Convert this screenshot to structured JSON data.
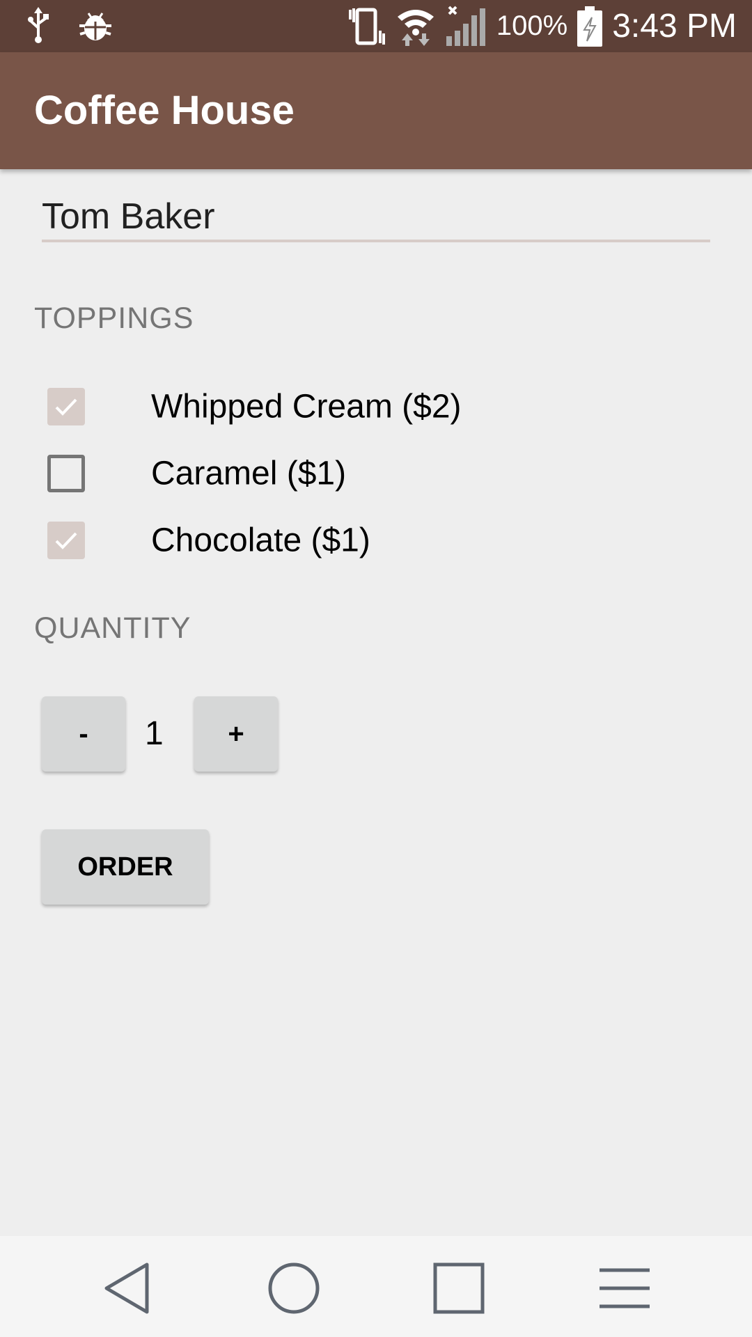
{
  "status_bar": {
    "battery_text": "100%",
    "time": "3:43 PM",
    "icons": [
      "usb-icon",
      "bug-icon",
      "vibrate-icon",
      "wifi-icon",
      "signal-icon",
      "battery-charging-icon"
    ]
  },
  "app_bar": {
    "title": "Coffee House"
  },
  "form": {
    "name_value": "Tom Baker",
    "toppings_label": "TOPPINGS",
    "toppings": [
      {
        "label": "Whipped Cream ($2)",
        "checked": true
      },
      {
        "label": "Caramel ($1)",
        "checked": false
      },
      {
        "label": "Chocolate ($1)",
        "checked": true
      }
    ],
    "quantity_label": "QUANTITY",
    "decrement_label": "-",
    "quantity": "1",
    "increment_label": "+",
    "order_label": "ORDER"
  },
  "nav_bar": {
    "icons": [
      "back-icon",
      "home-icon",
      "recents-icon",
      "menu-icon"
    ]
  },
  "colors": {
    "status_bar": "#5d4037",
    "app_bar": "#795548",
    "background": "#eeeeee",
    "checkbox_checked": "#d7ccc8",
    "button": "#d6d7d7"
  }
}
